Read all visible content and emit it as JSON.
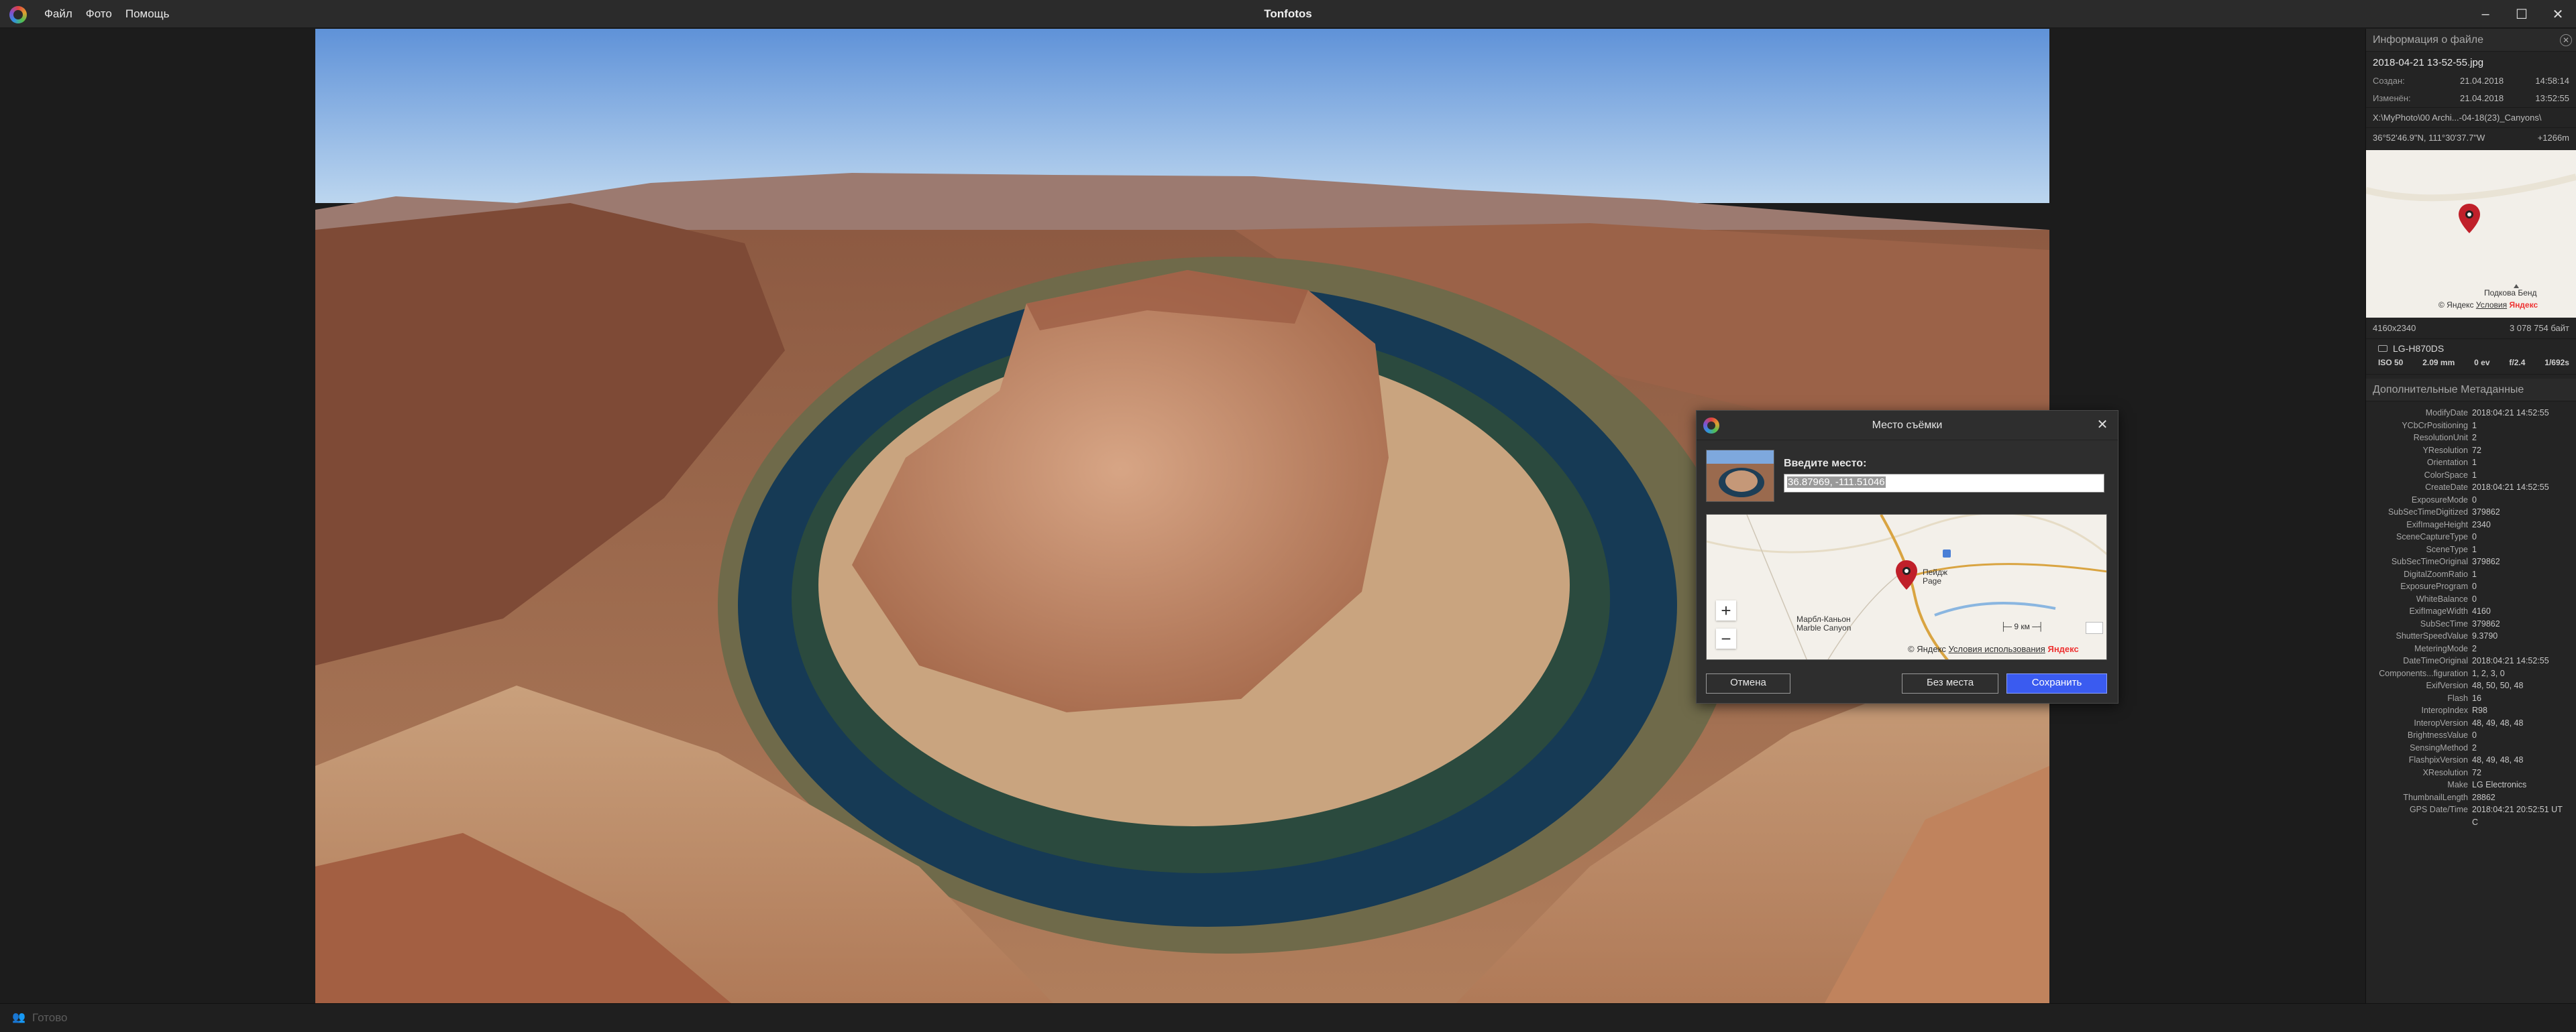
{
  "app": {
    "title": "Tonfotos",
    "menu": [
      "Файл",
      "Фото",
      "Помощь"
    ],
    "window_controls": [
      "minimize-icon",
      "maximize-icon",
      "close-icon"
    ]
  },
  "file_info": {
    "header": "Информация о файле",
    "file_name": "2018-04-21 13-52-55.jpg",
    "created_label": "Создан:",
    "created_date": "21.04.2018",
    "created_time": "14:58:14",
    "modified_label": "Изменён:",
    "modified_date": "21.04.2018",
    "modified_time": "13:52:55",
    "path": "X:\\MyPhoto\\00 Archi...-04-18(23)_Canyons\\",
    "coords": "36°52'46.9\"N, 111°30'37.7\"W",
    "altitude": "+1266m",
    "map_place": "Подкова Бенд",
    "map_copyright_prefix": "© Яндекс",
    "map_terms": "Условия",
    "map_brand": "Яндекс",
    "dimensions": "4160x2340",
    "file_size": "3 078 754 байт",
    "camera": "LG-H870DS",
    "exif": [
      "ISO 50",
      "2.09 mm",
      "0 ev",
      "f/2.4",
      "1/692s"
    ]
  },
  "metadata": {
    "header": "Дополнительные Метаданные",
    "rows": [
      {
        "k": "ModifyDate",
        "v": "2018:04:21 14:52:55"
      },
      {
        "k": "YCbCrPositioning",
        "v": "1"
      },
      {
        "k": "ResolutionUnit",
        "v": "2"
      },
      {
        "k": "YResolution",
        "v": "72"
      },
      {
        "k": "Orientation",
        "v": "1"
      },
      {
        "k": "ColorSpace",
        "v": "1"
      },
      {
        "k": "CreateDate",
        "v": "2018:04:21 14:52:55"
      },
      {
        "k": "ExposureMode",
        "v": "0"
      },
      {
        "k": "SubSecTimeDigitized",
        "v": "379862"
      },
      {
        "k": "ExifImageHeight",
        "v": "2340"
      },
      {
        "k": "SceneCaptureType",
        "v": "0"
      },
      {
        "k": "SceneType",
        "v": "1"
      },
      {
        "k": "SubSecTimeOriginal",
        "v": "379862"
      },
      {
        "k": "DigitalZoomRatio",
        "v": "1"
      },
      {
        "k": "ExposureProgram",
        "v": "0"
      },
      {
        "k": "WhiteBalance",
        "v": "0"
      },
      {
        "k": "ExifImageWidth",
        "v": "4160"
      },
      {
        "k": "SubSecTime",
        "v": "379862"
      },
      {
        "k": "ShutterSpeedValue",
        "v": "9.3790"
      },
      {
        "k": "MeteringMode",
        "v": "2"
      },
      {
        "k": "DateTimeOriginal",
        "v": "2018:04:21 14:52:55"
      },
      {
        "k": "Components...figuration",
        "v": "1, 2, 3, 0"
      },
      {
        "k": "ExifVersion",
        "v": "48, 50, 50, 48"
      },
      {
        "k": "Flash",
        "v": "16"
      },
      {
        "k": "InteropIndex",
        "v": "R98"
      },
      {
        "k": "InteropVersion",
        "v": "48, 49, 48, 48"
      },
      {
        "k": "BrightnessValue",
        "v": "0"
      },
      {
        "k": "SensingMethod",
        "v": "2"
      },
      {
        "k": "FlashpixVersion",
        "v": "48, 49, 48, 48"
      },
      {
        "k": "XResolution",
        "v": "72"
      },
      {
        "k": "Make",
        "v": "LG Electronics"
      },
      {
        "k": "ThumbnailLength",
        "v": "28862"
      },
      {
        "k": "GPS Date/Time",
        "v": "2018:04:21 20:52:51 UT"
      },
      {
        "k": "",
        "v": "C"
      }
    ]
  },
  "dialog": {
    "title": "Место съёмки",
    "prompt": "Введите место:",
    "input_value": "36.87969, -111.51046",
    "map": {
      "zoom_in": "+",
      "zoom_out": "−",
      "city_ru": "Пейдж",
      "city_en": "Page",
      "canyon_ru": "Марбл-Каньон",
      "canyon_en": "Marble Canyon",
      "scale": "9 км",
      "copyright_prefix": "© Яндекс",
      "terms": "Условия использования",
      "brand": "Яндекс"
    },
    "buttons": {
      "cancel": "Отмена",
      "no_place": "Без места",
      "save": "Сохранить"
    }
  },
  "status": {
    "text": "Готово"
  },
  "colors": {
    "accent": "#3a5bf0",
    "marker": "#c0202a",
    "status_icon": "#c9b23b"
  }
}
